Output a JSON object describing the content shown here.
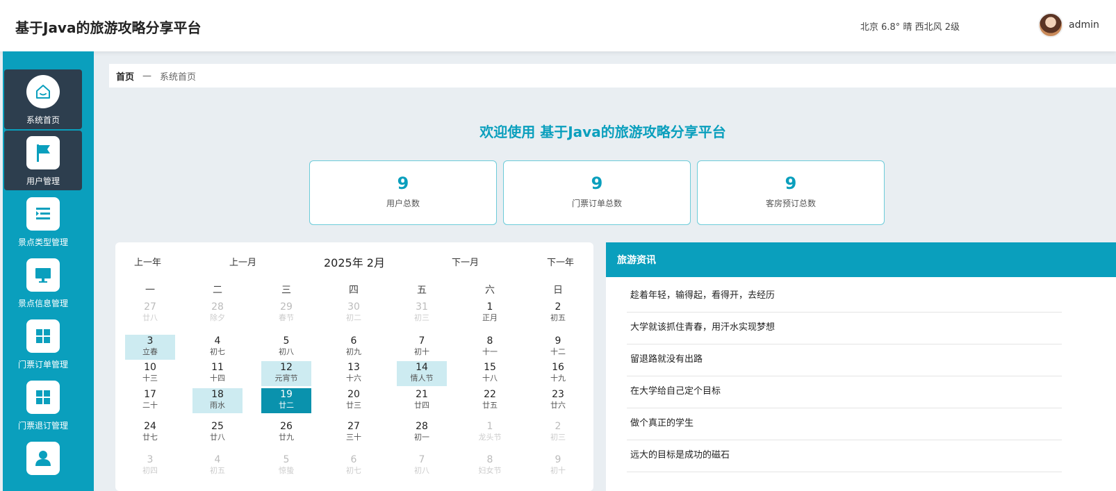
{
  "app": {
    "title": "基于Java的旅游攻略分享平台"
  },
  "header": {
    "weather": "北京  6.8°  晴  西北风  2级",
    "username": "admin"
  },
  "sidebar": {
    "items": [
      {
        "label": "系统首页"
      },
      {
        "label": "用户管理"
      },
      {
        "label": "景点类型管理"
      },
      {
        "label": "景点信息管理"
      },
      {
        "label": "门票订单管理"
      },
      {
        "label": "门票退订管理"
      },
      {
        "label": ""
      }
    ]
  },
  "breadcrumb": {
    "home": "首页",
    "separator": "—",
    "current": "系统首页"
  },
  "welcome": "欢迎使用 基于Java的旅游攻略分享平台",
  "stats": [
    {
      "value": "9",
      "label": "用户总数"
    },
    {
      "value": "9",
      "label": "门票订单总数"
    },
    {
      "value": "9",
      "label": "客房预订总数"
    }
  ],
  "calendar": {
    "prev_year": "上一年",
    "prev_month": "上一月",
    "month_label": "2025年 2月",
    "next_month": "下一月",
    "next_year": "下一年",
    "weekdays": [
      "一",
      "二",
      "三",
      "四",
      "五",
      "六",
      "日"
    ],
    "rows": [
      [
        {
          "n": "27",
          "l": "廿八",
          "o": 1
        },
        {
          "n": "28",
          "l": "除夕",
          "o": 1
        },
        {
          "n": "29",
          "l": "春节",
          "o": 1
        },
        {
          "n": "30",
          "l": "初二",
          "o": 1
        },
        {
          "n": "31",
          "l": "初三",
          "o": 1
        },
        {
          "n": "1",
          "l": "正月"
        },
        {
          "n": "2",
          "l": "初五"
        }
      ],
      [
        {
          "n": "3",
          "l": "立春",
          "h": 1
        },
        {
          "n": "4",
          "l": "初七"
        },
        {
          "n": "5",
          "l": "初八"
        },
        {
          "n": "6",
          "l": "初九"
        },
        {
          "n": "7",
          "l": "初十"
        },
        {
          "n": "8",
          "l": "十一"
        },
        {
          "n": "9",
          "l": "十二"
        }
      ],
      [
        {
          "n": "10",
          "l": "十三"
        },
        {
          "n": "11",
          "l": "十四"
        },
        {
          "n": "12",
          "l": "元宵节",
          "h": 1
        },
        {
          "n": "13",
          "l": "十六"
        },
        {
          "n": "14",
          "l": "情人节",
          "h": 1
        },
        {
          "n": "15",
          "l": "十八"
        },
        {
          "n": "16",
          "l": "十九"
        }
      ],
      [
        {
          "n": "17",
          "l": "二十"
        },
        {
          "n": "18",
          "l": "雨水",
          "h": 1
        },
        {
          "n": "19",
          "l": "廿二",
          "t": 1
        },
        {
          "n": "20",
          "l": "廿三"
        },
        {
          "n": "21",
          "l": "廿四"
        },
        {
          "n": "22",
          "l": "廿五"
        },
        {
          "n": "23",
          "l": "廿六"
        }
      ],
      [
        {
          "n": "24",
          "l": "廿七"
        },
        {
          "n": "25",
          "l": "廿八"
        },
        {
          "n": "26",
          "l": "廿九"
        },
        {
          "n": "27",
          "l": "三十"
        },
        {
          "n": "28",
          "l": "初一"
        },
        {
          "n": "1",
          "l": "龙头节",
          "o": 1
        },
        {
          "n": "2",
          "l": "初三",
          "o": 1
        }
      ],
      [
        {
          "n": "3",
          "l": "初四",
          "o": 1
        },
        {
          "n": "4",
          "l": "初五",
          "o": 1
        },
        {
          "n": "5",
          "l": "惊蛰",
          "o": 1
        },
        {
          "n": "6",
          "l": "初七",
          "o": 1
        },
        {
          "n": "7",
          "l": "初八",
          "o": 1
        },
        {
          "n": "8",
          "l": "妇女节",
          "o": 1
        },
        {
          "n": "9",
          "l": "初十",
          "o": 1
        }
      ]
    ]
  },
  "news": {
    "title": "旅游资讯",
    "items": [
      "趁着年轻，输得起，看得开，去经历",
      "大学就该抓住青春，用汗水实现梦想",
      "留退路就没有出路",
      "在大学给自己定个目标",
      "做个真正的学生",
      "远大的目标是成功的磁石"
    ]
  }
}
